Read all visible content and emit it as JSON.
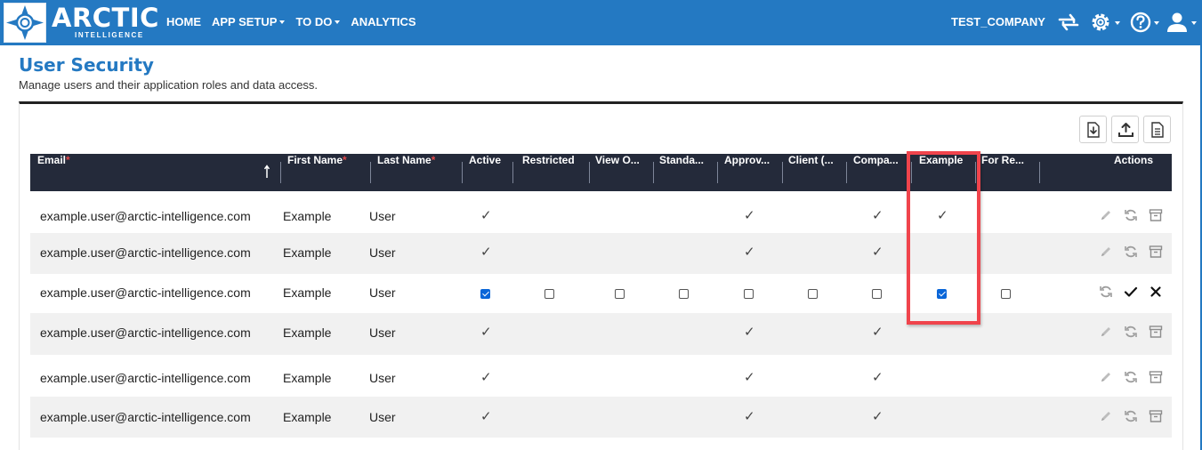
{
  "brand": {
    "name": "ARCTIC",
    "sub": "INTELLIGENCE"
  },
  "nav": [
    {
      "label": "HOME",
      "dropdown": false
    },
    {
      "label": "APP SETUP",
      "dropdown": true
    },
    {
      "label": "TO DO",
      "dropdown": true
    },
    {
      "label": "ANALYTICS",
      "dropdown": false
    }
  ],
  "company": "TEST_COMPANY",
  "toolbar_icons": [
    "swap-icon",
    "gear-icon",
    "help-icon",
    "user-icon"
  ],
  "page": {
    "title": "User Security",
    "subtitle": "Manage users and their application roles and data access."
  },
  "table_tools": [
    "download-icon",
    "upload-icon",
    "document-icon"
  ],
  "columns": [
    {
      "label": "Email",
      "required": true
    },
    {
      "label": "First Name",
      "required": true
    },
    {
      "label": "Last Name",
      "required": true
    },
    {
      "label": "Active",
      "required": false
    },
    {
      "label": "Restricted",
      "required": false
    },
    {
      "label": "View O...",
      "required": false
    },
    {
      "label": "Standa...",
      "required": false
    },
    {
      "label": "Approv...",
      "required": false
    },
    {
      "label": "Client (...",
      "required": false
    },
    {
      "label": "Compa...",
      "required": false
    },
    {
      "label": "Example",
      "required": false
    },
    {
      "label": "For Re...",
      "required": false
    },
    {
      "label": "Actions",
      "required": false
    }
  ],
  "sort_icon": "sort-up-icon",
  "rows": [
    {
      "email": "example.user@arctic-intelligence.com",
      "first": "Example",
      "last": "User",
      "editing": false,
      "flags": [
        true,
        false,
        false,
        false,
        true,
        false,
        true,
        true,
        false
      ]
    },
    {
      "email": "example.user@arctic-intelligence.com",
      "first": "Example",
      "last": "User",
      "editing": false,
      "flags": [
        true,
        false,
        false,
        false,
        true,
        false,
        true,
        false,
        false
      ]
    },
    {
      "email": "example.user@arctic-intelligence.com",
      "first": "Example",
      "last": "User",
      "editing": true,
      "flags": [
        true,
        false,
        false,
        false,
        false,
        false,
        false,
        true,
        false
      ]
    },
    {
      "email": "example.user@arctic-intelligence.com",
      "first": "Example",
      "last": "User",
      "editing": false,
      "flags": [
        true,
        false,
        false,
        false,
        true,
        false,
        true,
        false,
        false
      ]
    },
    {
      "email": "example.user@arctic-intelligence.com",
      "first": "Example",
      "last": "User",
      "editing": false,
      "flags": [
        true,
        false,
        false,
        false,
        true,
        false,
        true,
        false,
        false
      ]
    },
    {
      "email": "example.user@arctic-intelligence.com",
      "first": "Example",
      "last": "User",
      "editing": false,
      "flags": [
        true,
        false,
        false,
        false,
        true,
        false,
        true,
        false,
        false
      ]
    }
  ],
  "row_actions": [
    "edit-icon",
    "reset-icon",
    "archive-icon"
  ],
  "edit_actions": [
    "reset-icon",
    "confirm-icon",
    "cancel-icon"
  ],
  "colors": {
    "brand_blue": "#2479c2",
    "header_dark": "#242a3a",
    "highlight": "#f0444c",
    "checkbox_on": "#0a66d8"
  }
}
